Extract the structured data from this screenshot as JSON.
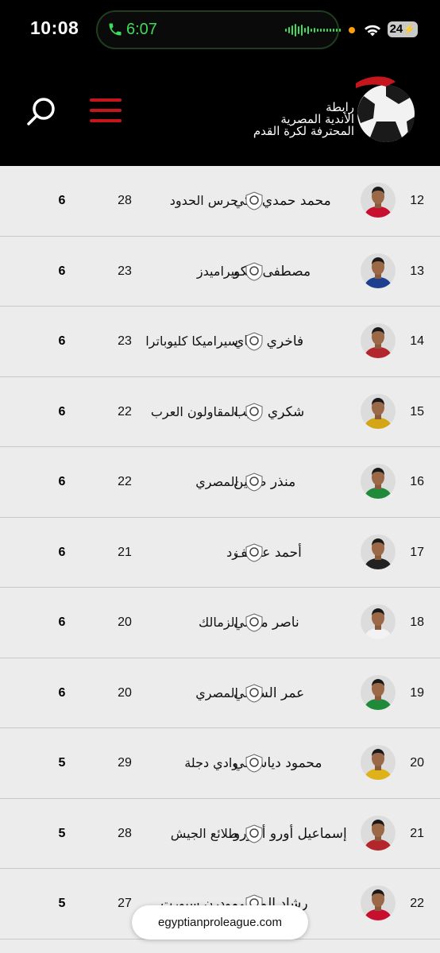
{
  "status_bar": {
    "time": "10:08",
    "call_duration": "6:07",
    "battery": "24"
  },
  "header": {
    "logo_lines": [
      "رابطة",
      "الأندية المصرية",
      "المحترفة لكرة القدم"
    ]
  },
  "colors": {
    "accent": "#c4161c",
    "call_green": "#3ddc5a",
    "header_bg": "#000000"
  },
  "rows": [
    {
      "rank": "12",
      "player": "محمد حمدي زكي",
      "club": "حرس الحدود",
      "matches": "28",
      "goals": "6",
      "shirt": "#c8102e"
    },
    {
      "rank": "13",
      "player": "مصطفى زيكو",
      "club": "بيراميدز",
      "matches": "23",
      "goals": "6",
      "shirt": "#1d3f8f"
    },
    {
      "rank": "14",
      "player": "فاخري لاكاي",
      "club": "سيراميكا كليوباترا",
      "matches": "23",
      "goals": "6",
      "shirt": "#b3262b"
    },
    {
      "rank": "15",
      "player": "شكري نجيب",
      "club": "المقاولون العرب",
      "matches": "22",
      "goals": "6",
      "shirt": "#d4a514"
    },
    {
      "rank": "16",
      "player": "منذر طمين",
      "club": "المصري",
      "matches": "22",
      "goals": "6",
      "shirt": "#1f8a3a"
    },
    {
      "rank": "17",
      "player": "أحمد عاطف",
      "club": "زد",
      "matches": "21",
      "goals": "6",
      "shirt": "#222222"
    },
    {
      "rank": "18",
      "player": "ناصر منسي",
      "club": "الزمالك",
      "matches": "20",
      "goals": "6",
      "shirt": "#f2f2f2"
    },
    {
      "rank": "19",
      "player": "عمر الساعي",
      "club": "المصري",
      "matches": "20",
      "goals": "6",
      "shirt": "#1f8a3a"
    },
    {
      "rank": "20",
      "player": "محمود دياسطي",
      "club": "وادي دجلة",
      "matches": "29",
      "goals": "5",
      "shirt": "#e0b21a"
    },
    {
      "rank": "21",
      "player": "إسماعيل أورو أجورو",
      "club": "طلائع الجيش",
      "matches": "28",
      "goals": "5",
      "shirt": "#b3262b"
    },
    {
      "rank": "22",
      "player": "رشاد المتولى",
      "club": "مودرن سبورت",
      "matches": "27",
      "goals": "5",
      "shirt": "#c8102e"
    }
  ],
  "url": "egyptianproleague.com"
}
